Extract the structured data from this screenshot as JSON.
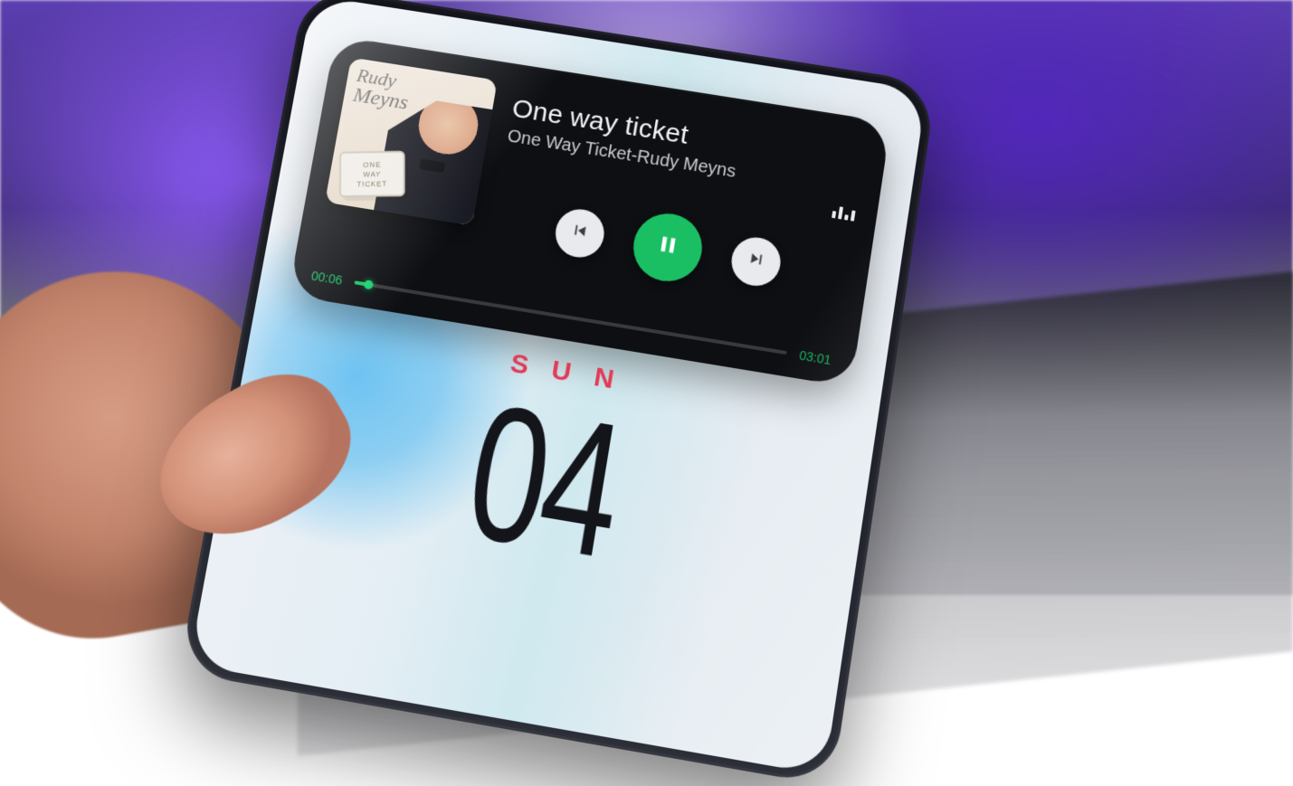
{
  "player": {
    "track_title": "One way ticket",
    "track_subtitle": "One Way Ticket-Rudy Meyns",
    "elapsed": "00:06",
    "duration": "03:01",
    "progress_pct": 3.3,
    "state": "playing",
    "album_art": {
      "line1": "Rudy",
      "line2": "Meyns",
      "ticket_l1": "ONE",
      "ticket_l2": "WAY",
      "ticket_l3": "TICKET"
    },
    "icons": {
      "prev": "skip-previous-icon",
      "play_pause": "pause-icon",
      "next": "skip-next-icon",
      "equalizer": "equalizer-icon"
    },
    "accent_color": "#1bbf63"
  },
  "date_widget": {
    "day_of_week": "SUN",
    "day_of_month": "04"
  }
}
